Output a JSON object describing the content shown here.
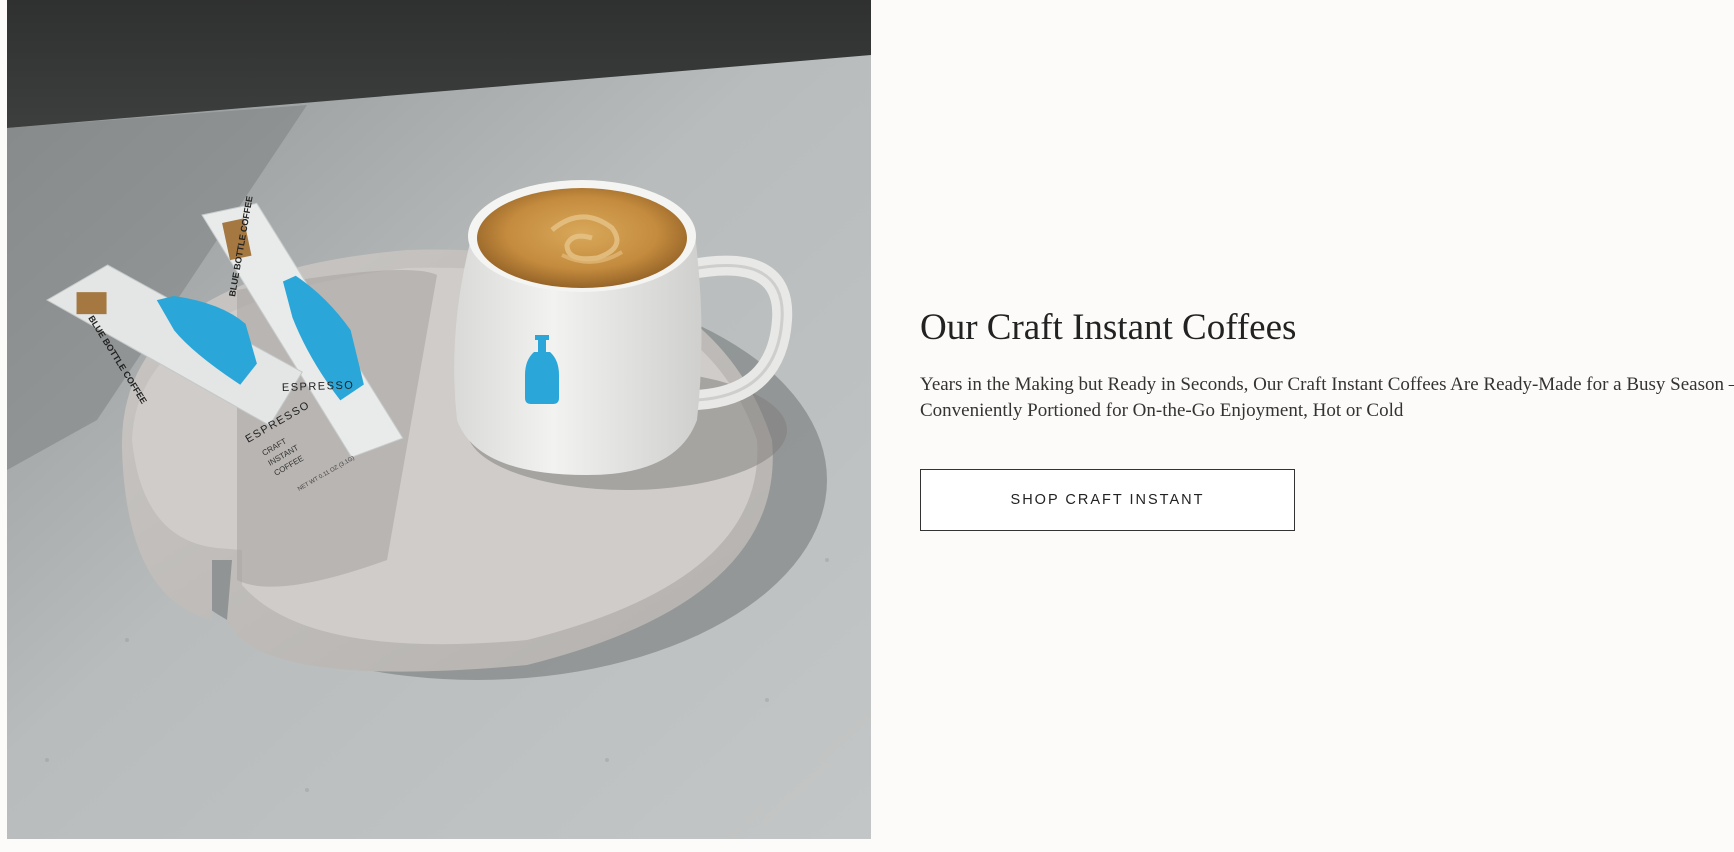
{
  "hero": {
    "image_alt": "Craft instant espresso packets beside a white cup of coffee on a concrete tray",
    "packet_brand": "BLUE BOTTLE COFFEE",
    "packet_product": "ESPRESSO",
    "packet_desc_1": "CRAFT",
    "packet_desc_2": "INSTANT",
    "packet_desc_3": "COFFEE",
    "packet_weight": "NET WT 0.11 OZ (3.1G)"
  },
  "content": {
    "heading": "Our Craft Instant Coffees",
    "description": "Years in the Making but Ready in Seconds, Our Craft Instant Coffees Are Ready-Made for a Busy Season — Conveniently Portioned for On-the-Go Enjoyment, Hot or Cold",
    "cta_label": "SHOP CRAFT INSTANT"
  },
  "colors": {
    "background": "#fcfbf9",
    "brand_blue": "#2aa7d8",
    "text": "#222222"
  }
}
